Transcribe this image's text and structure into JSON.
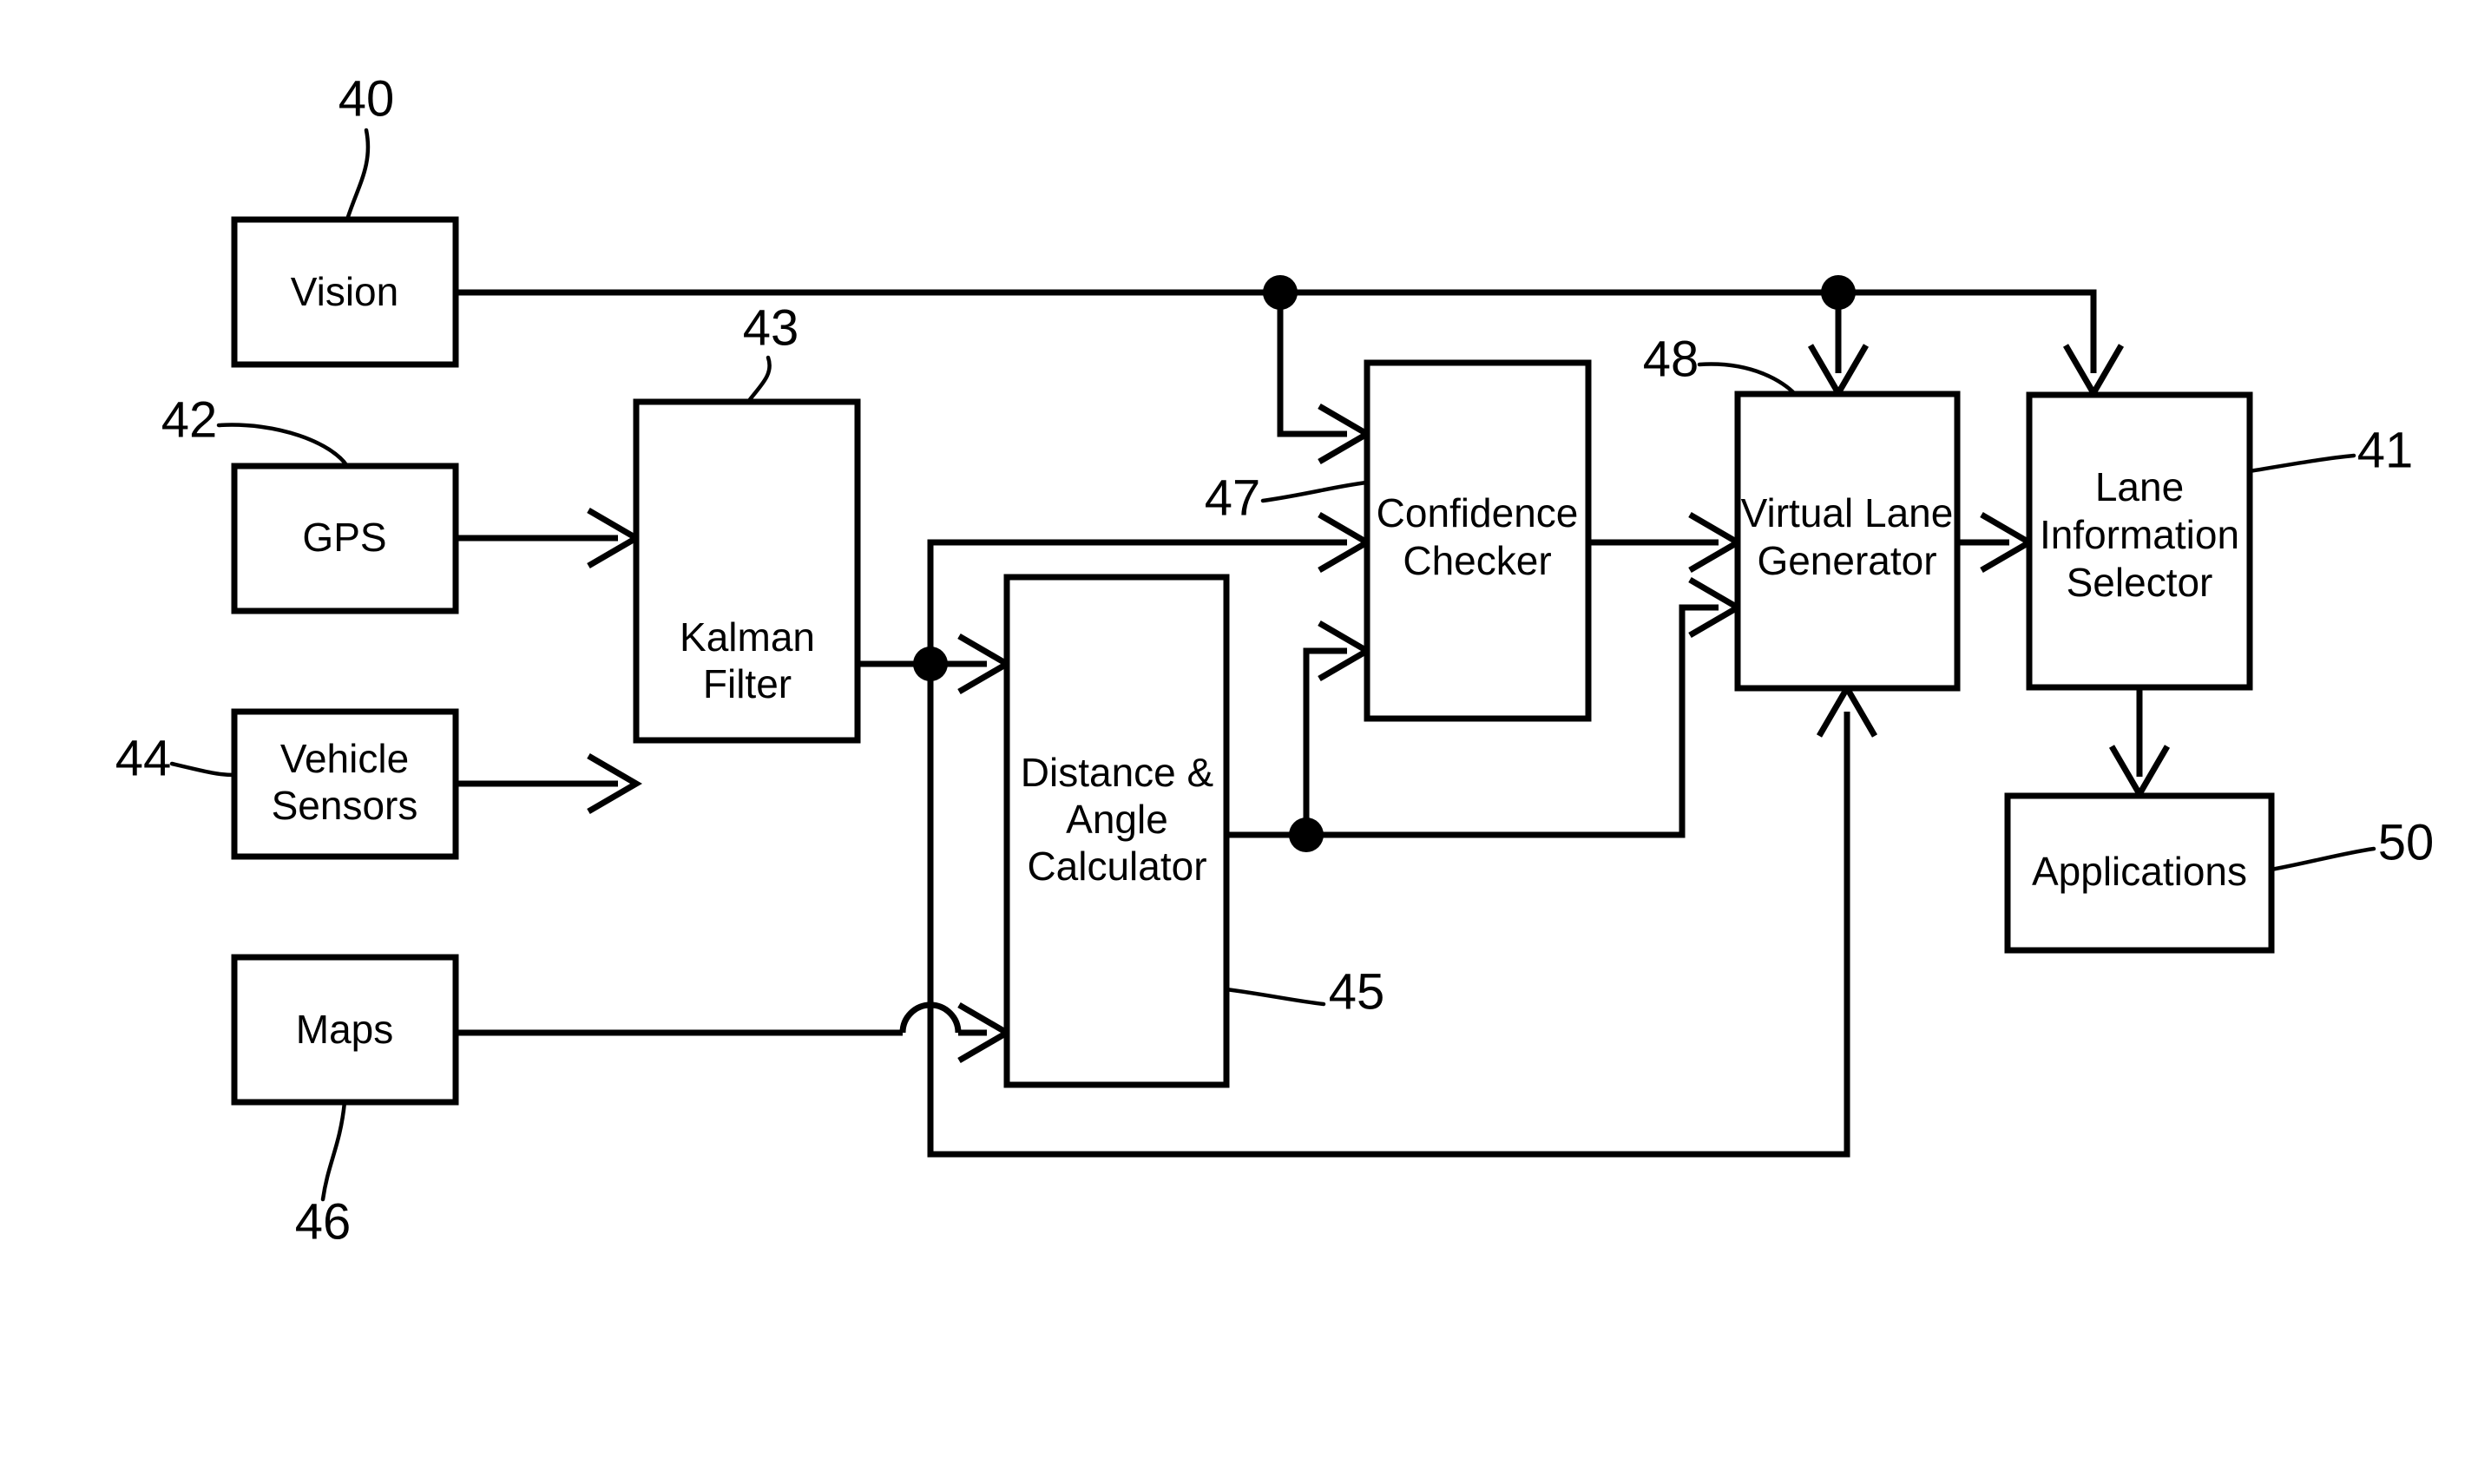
{
  "figure": {
    "type": "patent-block-diagram",
    "background_color": "#ffffff",
    "line_color": "#000000"
  },
  "blocks": {
    "vision": {
      "label": "Vision",
      "ref": "40"
    },
    "gps": {
      "label": "GPS",
      "ref": "42"
    },
    "vehicle_sensors": {
      "label_line1": "Vehicle",
      "label_line2": "Sensors",
      "ref": "44"
    },
    "maps": {
      "label": "Maps",
      "ref": "46"
    },
    "kalman_filter": {
      "label_line1": "Kalman",
      "label_line2": "Filter",
      "ref": "43"
    },
    "distance_angle_calculator": {
      "label_line1": "Distance &",
      "label_line2": "Angle",
      "label_line3": "Calculator",
      "ref": "45"
    },
    "confidence_checker": {
      "label_line1": "Confidence",
      "label_line2": "Checker",
      "ref": "47"
    },
    "virtual_lane_generator": {
      "label_line1": "Virtual Lane",
      "label_line2": "Generator",
      "ref": "48"
    },
    "lane_information_selector": {
      "label_line1": "Lane",
      "label_line2": "Information",
      "label_line3": "Selector",
      "ref": "41"
    },
    "applications": {
      "label": "Applications",
      "ref": "50"
    }
  },
  "reference_numerals": [
    "40",
    "41",
    "42",
    "43",
    "44",
    "45",
    "46",
    "47",
    "48",
    "50"
  ]
}
